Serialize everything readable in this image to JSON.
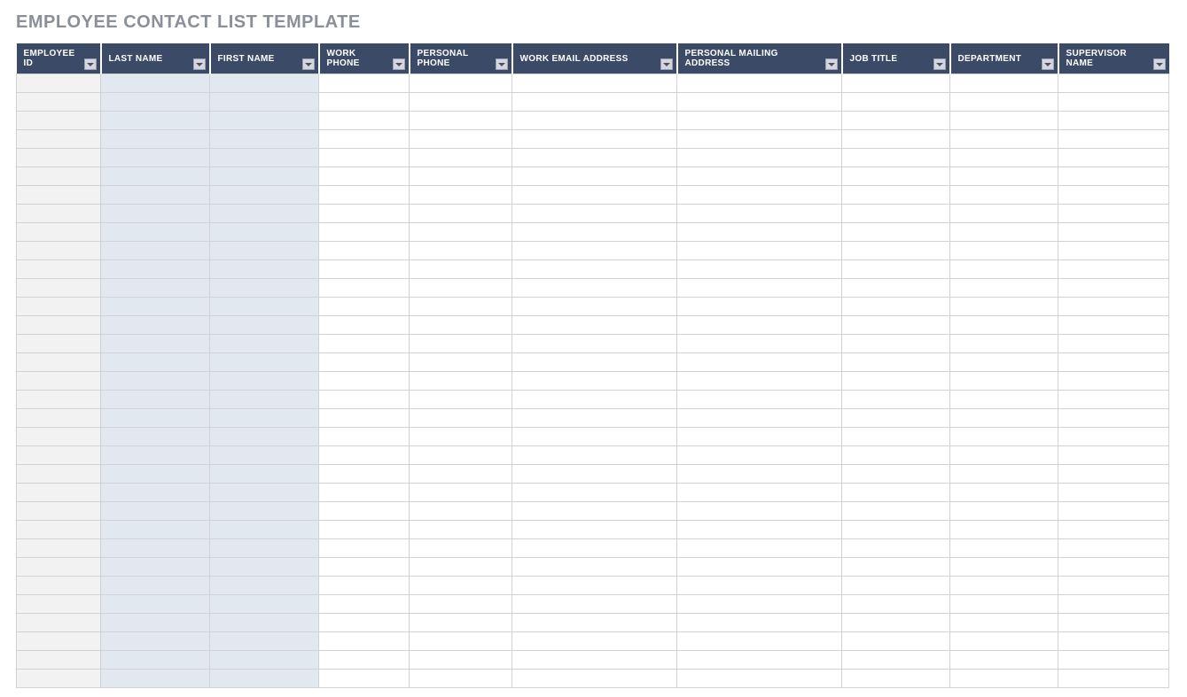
{
  "title": "EMPLOYEE CONTACT LIST TEMPLATE",
  "columns": [
    {
      "label": "EMPLOYEE ID",
      "shade": "a"
    },
    {
      "label": "LAST NAME",
      "shade": "b"
    },
    {
      "label": "FIRST NAME",
      "shade": "b"
    },
    {
      "label": "WORK PHONE",
      "shade": "plain"
    },
    {
      "label": "PERSONAL PHONE",
      "shade": "plain"
    },
    {
      "label": "WORK EMAIL ADDRESS",
      "shade": "plain"
    },
    {
      "label": "PERSONAL MAILING ADDRESS",
      "shade": "plain"
    },
    {
      "label": "JOB TITLE",
      "shade": "plain"
    },
    {
      "label": "DEPARTMENT",
      "shade": "plain"
    },
    {
      "label": "SUPERVISOR NAME",
      "shade": "plain"
    }
  ],
  "row_count": 33
}
